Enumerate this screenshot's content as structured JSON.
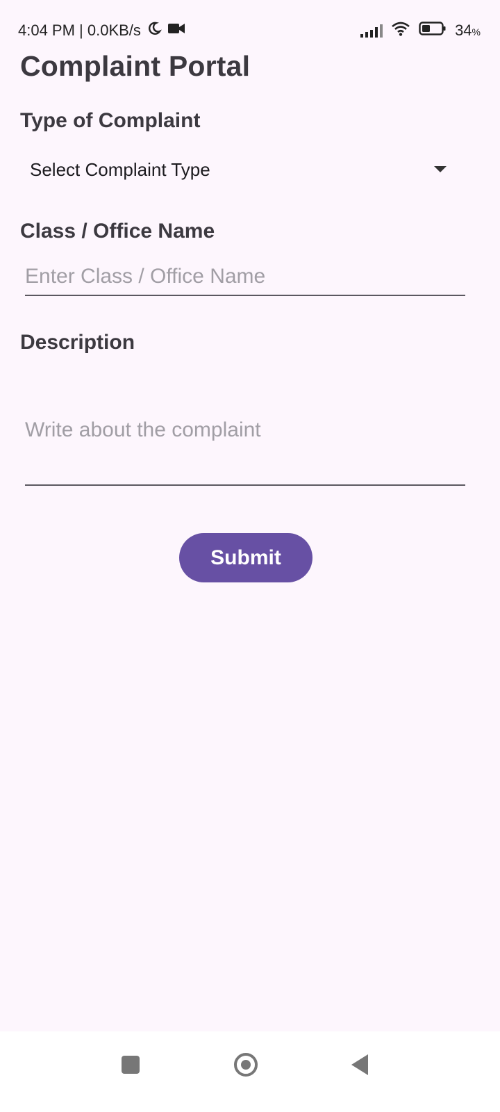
{
  "status_bar": {
    "time_and_speed": "4:04 PM | 0.0KB/s",
    "battery_percent": "34",
    "battery_unit": "%",
    "icons": [
      "moon-icon",
      "video-camera-icon",
      "signal-icon",
      "wifi-icon",
      "battery-icon"
    ]
  },
  "page": {
    "title": "Complaint Portal"
  },
  "form": {
    "type_label": "Type of Complaint",
    "type_selected": "Select Complaint Type",
    "class_label": "Class / Office Name",
    "class_placeholder": "Enter Class / Office Name",
    "description_label": "Description",
    "description_placeholder": "Write about the complaint",
    "submit_label": "Submit"
  },
  "colors": {
    "background": "#fdf6fd",
    "accent": "#6750a4",
    "label_text": "#3c3940",
    "placeholder_text": "#a19ea5"
  },
  "nav_bar": {
    "icons": [
      "recents-icon",
      "home-icon",
      "back-icon"
    ]
  }
}
